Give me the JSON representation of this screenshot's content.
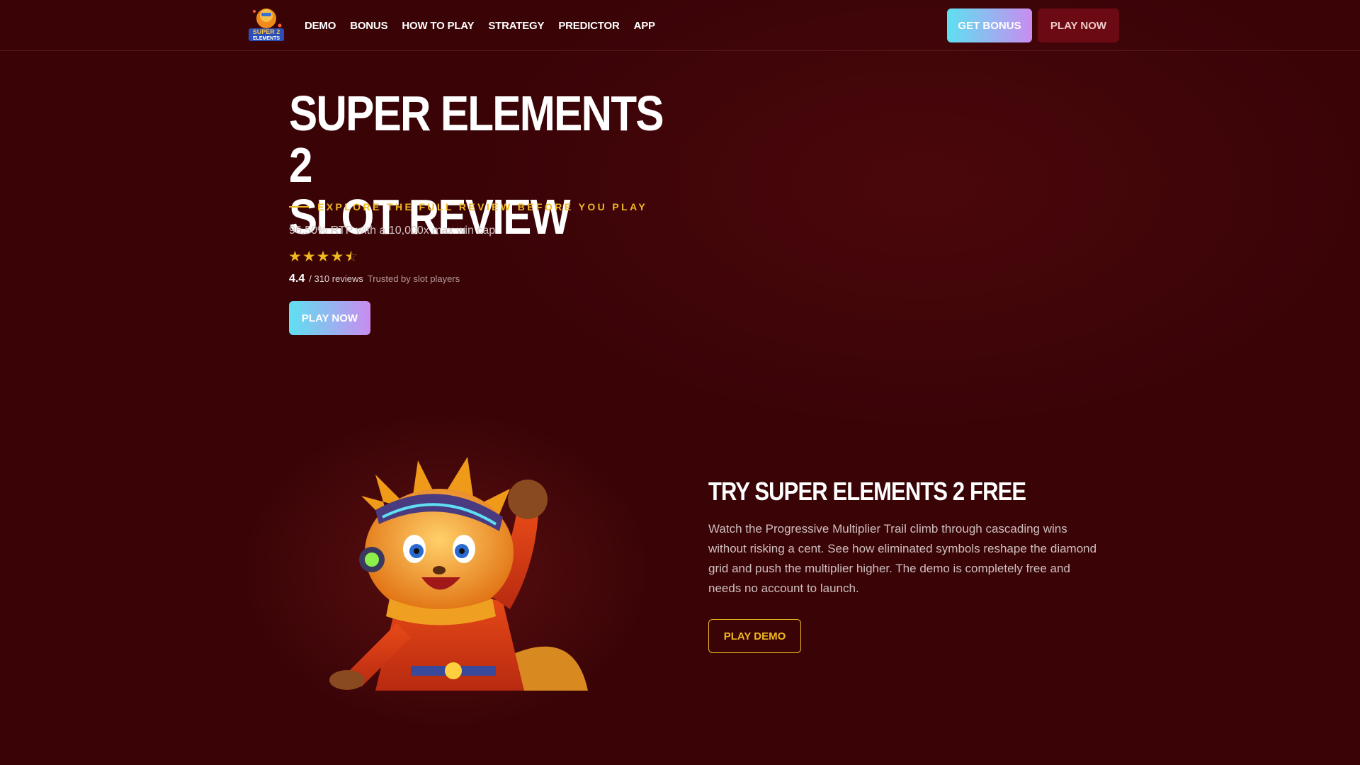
{
  "header": {
    "logo_alt": "Super Elements 2",
    "nav": [
      {
        "label": "DEMO"
      },
      {
        "label": "BONUS"
      },
      {
        "label": "HOW TO PLAY"
      },
      {
        "label": "STRATEGY"
      },
      {
        "label": "PREDICTOR"
      },
      {
        "label": "APP"
      }
    ],
    "get_bonus_label": "GET BONUS",
    "play_now_label": "PLAY NOW"
  },
  "hero": {
    "title_line1": "SUPER ELEMENTS 2",
    "title_line2": "SLOT REVIEW",
    "eyebrow": "EXPLORE THE FULL REVIEW BEFORE YOU PLAY",
    "description": "96.50% RTP with a 10,000x max win cap",
    "rating_stars": 4.4,
    "rating_score": "4.4",
    "rating_count": "/ 310 reviews",
    "trusted_text": "Trusted by slot players",
    "play_now_label": "PLAY NOW"
  },
  "demo": {
    "title": "TRY SUPER ELEMENTS 2 FREE",
    "text": "Watch the Progressive Multiplier Trail climb through cascading wins without risking a cent. See how eliminated symbols reshape the diamond grid and push the multiplier higher. The demo is completely free and needs no account to launch.",
    "play_demo_label": "PLAY DEMO"
  },
  "colors": {
    "background": "#3a0407",
    "accent_gold": "#f0b820",
    "gradient_start": "#5ee0f0",
    "gradient_end": "#c98cf0",
    "play_now_bg": "#6b0a12"
  }
}
